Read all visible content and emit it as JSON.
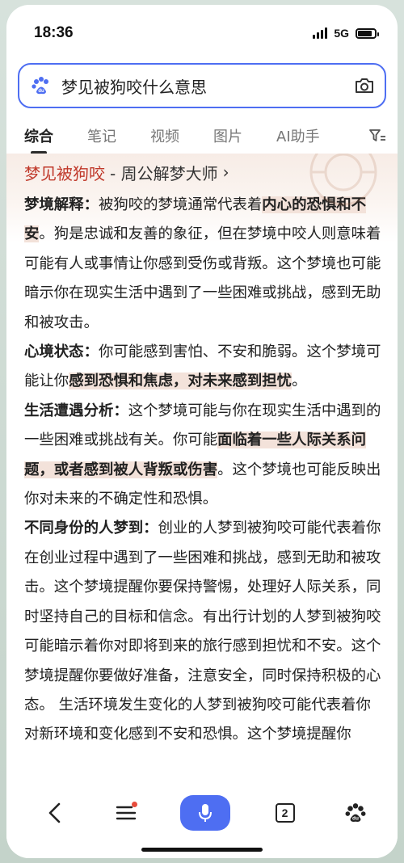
{
  "status_bar": {
    "time": "18:36",
    "network": "5G",
    "battery_level": 0.85
  },
  "search": {
    "query": "梦见被狗咬什么意思",
    "accent_color": "#4e6ef2"
  },
  "tabs": [
    {
      "label": "综合",
      "active": true
    },
    {
      "label": "笔记",
      "active": false
    },
    {
      "label": "视频",
      "active": false
    },
    {
      "label": "图片",
      "active": false
    },
    {
      "label": "AI助手",
      "active": false
    }
  ],
  "card": {
    "title_keyword": "梦见被狗咬",
    "title_rest": "- 周公解梦大师",
    "title_arrow": "›",
    "paragraphs": [
      {
        "label": "梦境解释：",
        "text_1": "被狗咬的梦境通常代表着",
        "highlight": "内心的恐惧和不安",
        "text_2": "。狗是忠诚和友善的象征，但在梦境中咬人则意味着可能有人或事情让你感到受伤或背叛。这个梦境也可能暗示你在现实生活中遇到了一些困难或挑战，感到无助和被攻击。"
      },
      {
        "label": "心境状态：",
        "text_1": "你可能感到害怕、不安和脆弱。这个梦境可能让你",
        "highlight": "感到恐惧和焦虑，对未来感到担忧",
        "text_2": "。"
      },
      {
        "label": "生活遭遇分析：",
        "text_1": "这个梦境可能与你在现实生活中遇到的一些困难或挑战有关。你可能",
        "highlight": "面临着一些人际关系问题，或者感到被人背叛或伤害",
        "text_2": "。这个梦境也可能反映出你对未来的不确定性和恐惧。"
      },
      {
        "label": "不同身份的人梦到：",
        "text_1": "创业的人梦到被狗咬可能代表着你在创业过程中遇到了一些困难和挑战，感到无助和被攻击。这个梦境提醒你要保持警惕，处理好人际关系，同时坚持自己的目标和信念。有出行计划的人梦到被狗咬可能暗示着你对即将到来的旅行感到担忧和不安。这个梦境提醒你要做好准备，注意安全，同时保持积极的心态。 生活环境发生变化的人梦到被狗咬可能代表着你对新环境和变化感到不安和恐惧。这个梦境提醒你",
        "highlight": "",
        "text_2": ""
      }
    ]
  },
  "bottom_bar": {
    "tab_count": "2"
  }
}
